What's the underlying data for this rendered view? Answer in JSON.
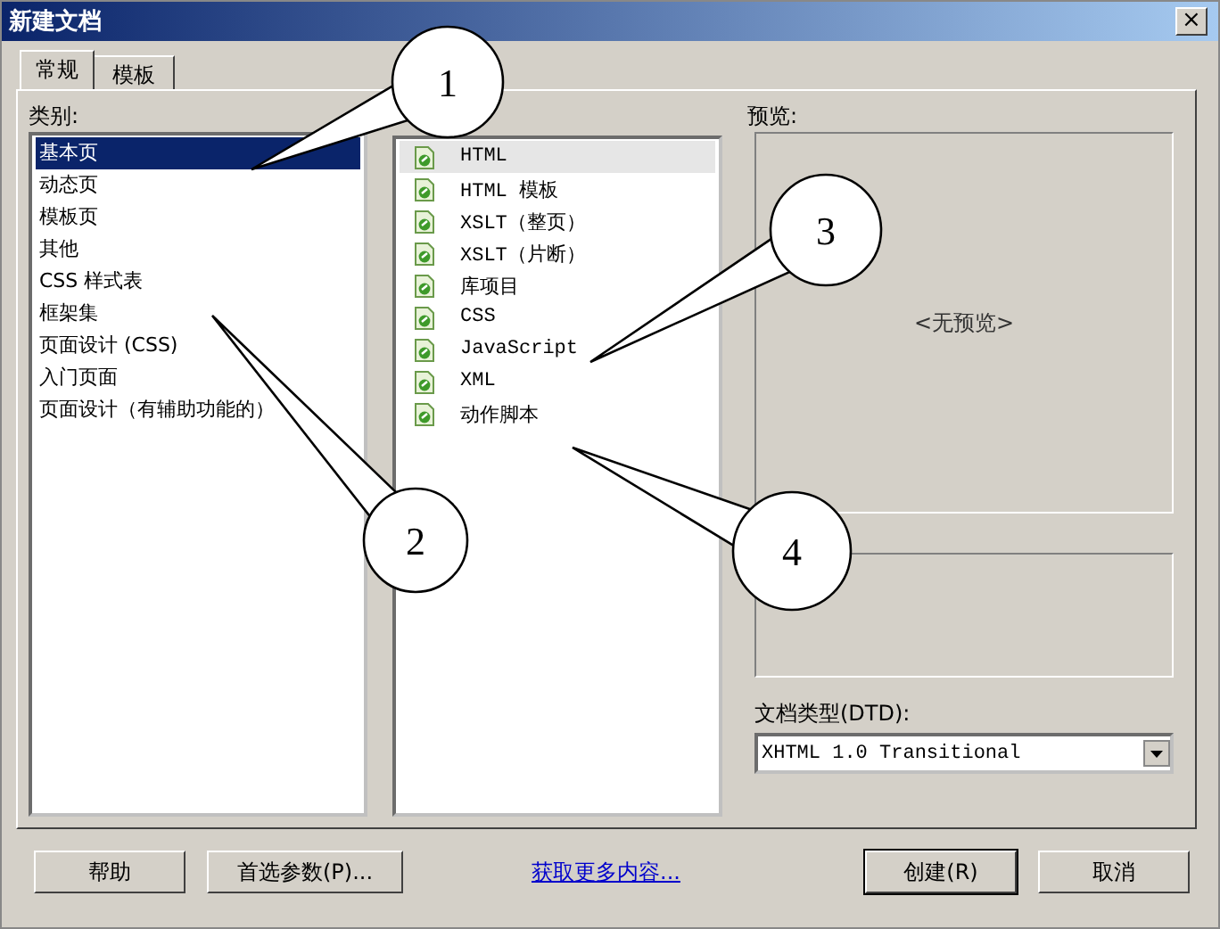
{
  "window": {
    "title": "新建文档",
    "close": "×"
  },
  "tabs": [
    {
      "label": "常规",
      "selected": true
    },
    {
      "label": "模板",
      "selected": false
    }
  ],
  "category_label": "类别:",
  "categories": [
    {
      "label": "基本页",
      "selected": true
    },
    {
      "label": "动态页",
      "selected": false
    },
    {
      "label": "模板页",
      "selected": false
    },
    {
      "label": "其他",
      "selected": false
    },
    {
      "label": "CSS 样式表",
      "selected": false
    },
    {
      "label": "框架集",
      "selected": false
    },
    {
      "label": "页面设计 (CSS)",
      "selected": false
    },
    {
      "label": "入门页面",
      "selected": false
    },
    {
      "label": "页面设计（有辅助功能的）",
      "selected": false
    }
  ],
  "page_types": [
    {
      "label": "HTML",
      "selected": true
    },
    {
      "label": "HTML 模板",
      "selected": false
    },
    {
      "label": "XSLT（整页）",
      "selected": false
    },
    {
      "label": "XSLT（片断）",
      "selected": false
    },
    {
      "label": "库项目",
      "selected": false
    },
    {
      "label": "CSS",
      "selected": false
    },
    {
      "label": "JavaScript",
      "selected": false
    },
    {
      "label": "XML",
      "selected": false
    },
    {
      "label": "动作脚本",
      "selected": false
    }
  ],
  "preview": {
    "label": "预览:",
    "text": "<无预览>"
  },
  "doctype": {
    "label": "文档类型(DTD):",
    "value": "XHTML 1.0 Transitional"
  },
  "buttons": {
    "help": "帮助",
    "prefs": "首选参数(P)...",
    "link": "获取更多内容...",
    "create": "创建(R)",
    "cancel": "取消"
  },
  "callouts": [
    {
      "number": "1"
    },
    {
      "number": "2"
    },
    {
      "number": "3"
    },
    {
      "number": "4"
    }
  ]
}
